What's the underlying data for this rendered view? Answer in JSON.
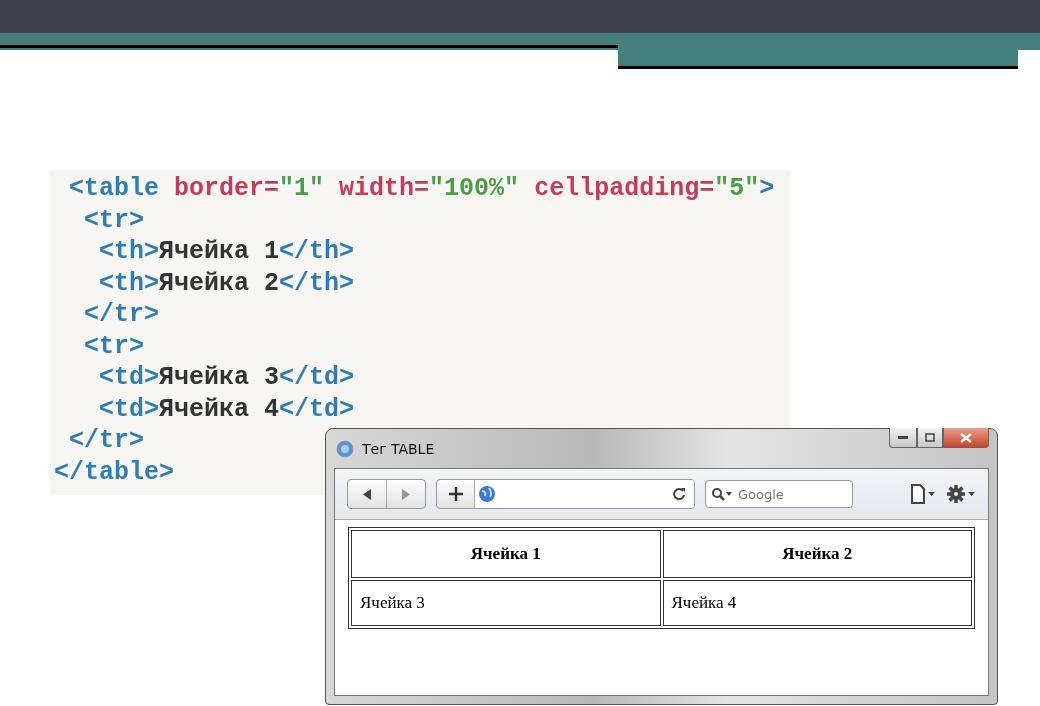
{
  "code": {
    "lines": [
      [
        {
          "kind": "tag",
          "text": " <table"
        },
        {
          "kind": "attr",
          "text": " border="
        },
        {
          "kind": "value",
          "text": "\"1\""
        },
        {
          "kind": "attr",
          "text": " width="
        },
        {
          "kind": "value",
          "text": "\"100%\""
        },
        {
          "kind": "attr",
          "text": " cellpadding="
        },
        {
          "kind": "value",
          "text": "\"5\""
        },
        {
          "kind": "tag",
          "text": ">"
        }
      ],
      [
        {
          "kind": "tag",
          "text": "  <tr>"
        }
      ],
      [
        {
          "kind": "tag",
          "text": "   <th>"
        },
        {
          "kind": "plain",
          "text": "Ячейка 1"
        },
        {
          "kind": "tag",
          "text": "</th>"
        }
      ],
      [
        {
          "kind": "tag",
          "text": "   <th>"
        },
        {
          "kind": "plain",
          "text": "Ячейка 2"
        },
        {
          "kind": "tag",
          "text": "</th>"
        }
      ],
      [
        {
          "kind": "tag",
          "text": "  </tr>"
        }
      ],
      [
        {
          "kind": "tag",
          "text": "  <tr>"
        }
      ],
      [
        {
          "kind": "tag",
          "text": "   <td>"
        },
        {
          "kind": "plain",
          "text": "Ячейка 3"
        },
        {
          "kind": "tag",
          "text": "</td>"
        }
      ],
      [
        {
          "kind": "tag",
          "text": "   <td>"
        },
        {
          "kind": "plain",
          "text": "Ячейка 4"
        },
        {
          "kind": "tag",
          "text": "</td>"
        }
      ],
      [
        {
          "kind": "tag",
          "text": " </tr>"
        }
      ],
      [
        {
          "kind": "tag",
          "text": "</table>"
        }
      ]
    ]
  },
  "browser": {
    "title": "Тег TABLE",
    "search": {
      "placeholder": "Google"
    },
    "table": {
      "columns": [
        "Ячейка 1",
        "Ячейка 2"
      ],
      "rows": [
        [
          "Ячейка 3",
          "Ячейка 4"
        ]
      ]
    }
  }
}
